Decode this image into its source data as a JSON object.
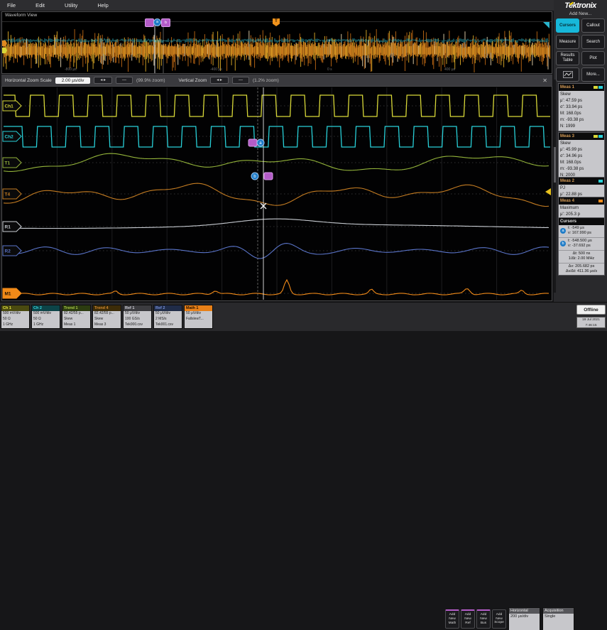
{
  "menu": {
    "items": [
      "File",
      "Edit",
      "Utility",
      "Help"
    ]
  },
  "overview": {
    "title": "Waveform View",
    "time_labels": [
      "-800 μs",
      "-400 μs",
      "0 s",
      "400 μs"
    ],
    "trigger_label": "T",
    "cursor_a": "a",
    "cursor_b": "b"
  },
  "zoom_bar": {
    "h_label": "Horizontal Zoom Scale",
    "h_value": "2.00 μs/div",
    "arrows": "◂ ▸",
    "minus": "—",
    "h_pct": "(99.9% zoom)",
    "v_label": "Vertical Zoom",
    "v_pct": "(1.2% zoom)",
    "close": "✕"
  },
  "channels": [
    {
      "handle": "Ch1",
      "color": "#d8d838",
      "type": "square"
    },
    {
      "handle": "Ch2",
      "color": "#28d0d8",
      "type": "square"
    },
    {
      "handle": "T1",
      "color": "#93b33a",
      "type": "trend"
    },
    {
      "handle": "T4",
      "color": "#c47c22",
      "type": "trend2"
    },
    {
      "handle": "R1",
      "color": "#c9cdd3",
      "type": "smooth"
    },
    {
      "handle": "R2",
      "color": "#5a74c9",
      "type": "ripple"
    },
    {
      "handle": "M1",
      "color": "#f18a18",
      "type": "spiky"
    }
  ],
  "sidebar": {
    "brand": "Tektronix",
    "add_new_label": "Add New...",
    "buttons": [
      {
        "label": "Cursors",
        "active": true
      },
      {
        "label": "Callout",
        "active": false
      },
      {
        "label": "Measure",
        "active": false
      },
      {
        "label": "Search",
        "active": false
      },
      {
        "label": "Results Table",
        "active": false
      },
      {
        "label": "Plot",
        "active": false
      },
      {
        "label": "",
        "active": false
      },
      {
        "label": "More...",
        "active": false
      }
    ]
  },
  "meas_panels": [
    {
      "title": "Meas 1",
      "name": "Skew",
      "lines": [
        "μ': 47.59 ps",
        "σ': 33.94 ps",
        "M: 168.0ps",
        "m: -93.38 ps",
        "N: 1999"
      ],
      "swatches": [
        "#d8d838",
        "#28d0d8"
      ]
    },
    {
      "title": "Meas 3",
      "name": "Skew",
      "lines": [
        "μ': 45.99 ps",
        "σ': 34.96 ps",
        "M: 168.0ps",
        "m: -93.38 ps",
        "N: 2000"
      ],
      "swatches": [
        "#d8d838",
        "#28d0d8"
      ]
    },
    {
      "title": "Meas 2",
      "name": "PJ",
      "lines": [
        "μ': 22.88 ps"
      ],
      "swatches": [
        "#28d0d8"
      ]
    },
    {
      "title": "Meas 4",
      "name": "Maximum",
      "lines": [
        "μ': 205.3 p"
      ],
      "swatches": [
        "#f18a18"
      ]
    }
  ],
  "cursors_panel": {
    "title": "Cursors",
    "a_label": "a",
    "a_t": "t: -549 μs",
    "a_v": "v: 167.990 ps",
    "b_label": "b",
    "b_t": "t: -548.500 μs",
    "b_v": "v: -37.692 ps",
    "dt": "Δt: 500 ns",
    "inv_dt": "1/Δt: 2.00 MHz",
    "dv": "Δv: 205.682 ps",
    "dvdt": "Δv/Δt: 411.36 μs/s"
  },
  "bottom_badges": [
    {
      "label": "Ch 1",
      "lines": [
        "500 mV/div",
        "50 Ω",
        "1 GHz"
      ],
      "header_bg": "#4a4a10",
      "header_fg": "#e0e040"
    },
    {
      "label": "Ch 2",
      "lines": [
        "500 mV/div",
        "50 Ω",
        "1 GHz"
      ],
      "header_bg": "#0c4448",
      "header_fg": "#38d4dc"
    },
    {
      "label": "Trend 1",
      "lines": [
        "82.42/55 p...",
        "Skew",
        "Meas 1"
      ],
      "header_bg": "#2c3c10",
      "header_fg": "#a8c848"
    },
    {
      "label": "Trend 4",
      "lines": [
        "82.42/55 p...",
        "Skew",
        "Meas 3"
      ],
      "header_bg": "#3c2c08",
      "header_fg": "#d08830"
    },
    {
      "label": "Ref 1",
      "lines": [
        "50 μV/div",
        "100 GS/s",
        "Tek000.csv"
      ],
      "header_bg": "#3c3c40",
      "header_fg": "#d0d0d8"
    },
    {
      "label": "Ref 2",
      "lines": [
        "50 μV/div",
        "2 MS/s",
        "Tek001.csv"
      ],
      "header_bg": "#202c48",
      "header_fg": "#7890d8"
    },
    {
      "label": "Math 1",
      "lines": [
        "50 μV/div",
        "FallslewT..."
      ],
      "header_bg": "#e88018",
      "header_fg": "#201000"
    }
  ],
  "bottom_right": {
    "add_buttons": [
      "Add New Math",
      "Add New Ref",
      "Add New Bus",
      "Add New Scope"
    ],
    "horizontal": {
      "title": "Horizontal",
      "value": "200 μs/div"
    },
    "acquisition": {
      "title": "Acquisition",
      "value": "Single"
    },
    "offline": "Offline",
    "date": "19 Jul 2021",
    "time": "7:46:15"
  }
}
